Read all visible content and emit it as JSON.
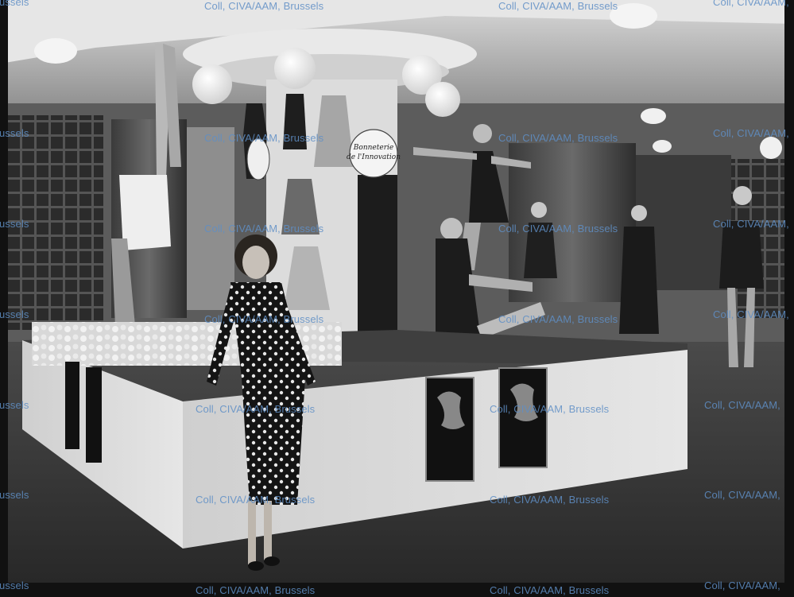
{
  "image": {
    "description_tags": [
      "photograph",
      "black-and-white",
      "department-store",
      "swimwear-display"
    ],
    "sign": {
      "line1": "Bonneterie",
      "line2": "de l'Innovation"
    },
    "watermark": {
      "text": "Coll, CIVA/AAM, Brussels",
      "text_short": "Coll, CIVA/AAM,",
      "text_tail": "ussels",
      "color": "#5f8fc6"
    }
  }
}
